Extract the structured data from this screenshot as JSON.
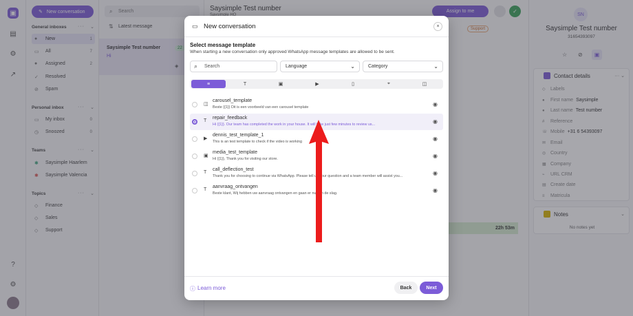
{
  "sidebar": {
    "new_conversation": "New conversation",
    "general_inboxes": "General inboxes",
    "general_items": [
      {
        "label": "New",
        "count": "1"
      },
      {
        "label": "All",
        "count": "7"
      },
      {
        "label": "Assigned",
        "count": "2"
      },
      {
        "label": "Resolved",
        "count": ""
      },
      {
        "label": "Spam",
        "count": ""
      }
    ],
    "personal_inbox": "Personal inbox",
    "personal_items": [
      {
        "label": "My inbox",
        "count": "0"
      },
      {
        "label": "Snoozed",
        "count": "0"
      }
    ],
    "teams": "Teams",
    "team_items": [
      {
        "label": "Saysimple Haarlem"
      },
      {
        "label": "Saysimple Valencia"
      }
    ],
    "topics": "Topics",
    "topic_items": [
      {
        "label": "Finance"
      },
      {
        "label": "Sales"
      },
      {
        "label": "Support"
      }
    ]
  },
  "conversations": {
    "search_placeholder": "Search",
    "sort": "Latest message",
    "item": {
      "title": "Saysimple Test number",
      "snippet": "Hi",
      "count": "22"
    }
  },
  "main": {
    "title": "Saysimple Test number",
    "subtitle": "Saysimple HQ",
    "assign": "Assign to me",
    "label_tag": "Support",
    "time": "22h 53m"
  },
  "contact": {
    "initials": "SN",
    "name": "Saysimple Test number",
    "phone": "31654393097",
    "details_title": "Contact details",
    "fields": [
      {
        "label": "Labels",
        "value": ""
      },
      {
        "label": "First name",
        "value": "Saysimple"
      },
      {
        "label": "Last name",
        "value": "Test number"
      },
      {
        "label": "Reference",
        "value": ""
      },
      {
        "label": "Mobile",
        "value": "+31 6 54393097"
      },
      {
        "label": "Email",
        "value": ""
      },
      {
        "label": "Country",
        "value": ""
      },
      {
        "label": "Company",
        "value": ""
      },
      {
        "label": "URL CRM",
        "value": ""
      },
      {
        "label": "Create date",
        "value": ""
      },
      {
        "label": "Matricula",
        "value": ""
      }
    ],
    "notes_title": "Notes",
    "no_notes": "No notes yet"
  },
  "modal": {
    "title": "New conversation",
    "section_title": "Select message template",
    "section_desc": "When starting a new conversation only approved WhatsApp message templates are allowed to be sent.",
    "search_placeholder": "Search",
    "language": "Language",
    "category": "Category",
    "templates": [
      {
        "name": "carousel_template",
        "desc": "Beste {{1}} Dit is een voorbeeld van een carousel template",
        "icon": "carousel-icon"
      },
      {
        "name": "repair_feedback",
        "desc": "Hi {{1}}. Our team has completed the work in your house. It will take just few minutes to review us...",
        "icon": "text-icon"
      },
      {
        "name": "dennis_test_template_1",
        "desc": "This is an test template to check if the video is working",
        "icon": "video-icon"
      },
      {
        "name": "media_test_template",
        "desc": "Hi {{1}}, Thank you for visiting our store.",
        "icon": "image-icon"
      },
      {
        "name": "call_deflection_test",
        "desc": "Thank you for choosing to continue via WhatsApp. Please tell us your question and a team member will assist you...",
        "icon": "text-icon"
      },
      {
        "name": "aanvraag_ontvangen",
        "desc": "Beste klant, Wij hebben uw aanvraag ontvangen en gaan er nu aan de slag.",
        "icon": "text-icon"
      }
    ],
    "learn_more": "Learn more",
    "back": "Back",
    "next": "Next"
  }
}
